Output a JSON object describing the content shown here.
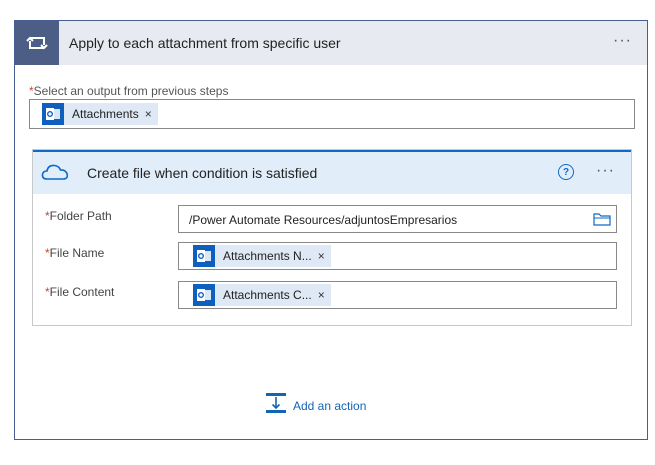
{
  "loop": {
    "title": "Apply to each attachment from specific user",
    "more": "···",
    "select_label_required": "*",
    "select_label": "Select an output from previous steps",
    "tokens": [
      {
        "label": "Attachments",
        "remove": "×"
      }
    ]
  },
  "action": {
    "title": "Create file when condition is satisfied",
    "help": "?",
    "more": "···",
    "fields": [
      {
        "required": "*",
        "label": "Folder Path",
        "value": "/Power Automate Resources/adjuntosEmpresarios"
      },
      {
        "required": "*",
        "label": "File Name",
        "token_label": "Attachments N...",
        "token_remove": "×"
      },
      {
        "required": "*",
        "label": "File Content",
        "token_label": "Attachments C...",
        "token_remove": "×"
      }
    ]
  },
  "footer": {
    "add_action_label": "Add an action"
  },
  "icons": {
    "loop": "loop-icon",
    "outlook": "outlook-icon",
    "onedrive": "onedrive-icon",
    "folder": "folder-icon",
    "help": "help-icon",
    "add_action": "add-action-icon"
  },
  "colors": {
    "loop_header_bg": "#e7eaf0",
    "loop_icon_bg": "#4c5e85",
    "action_header_bg": "#e1edf9",
    "onedrive_accent": "#0f69c7",
    "link": "#1464b4"
  }
}
